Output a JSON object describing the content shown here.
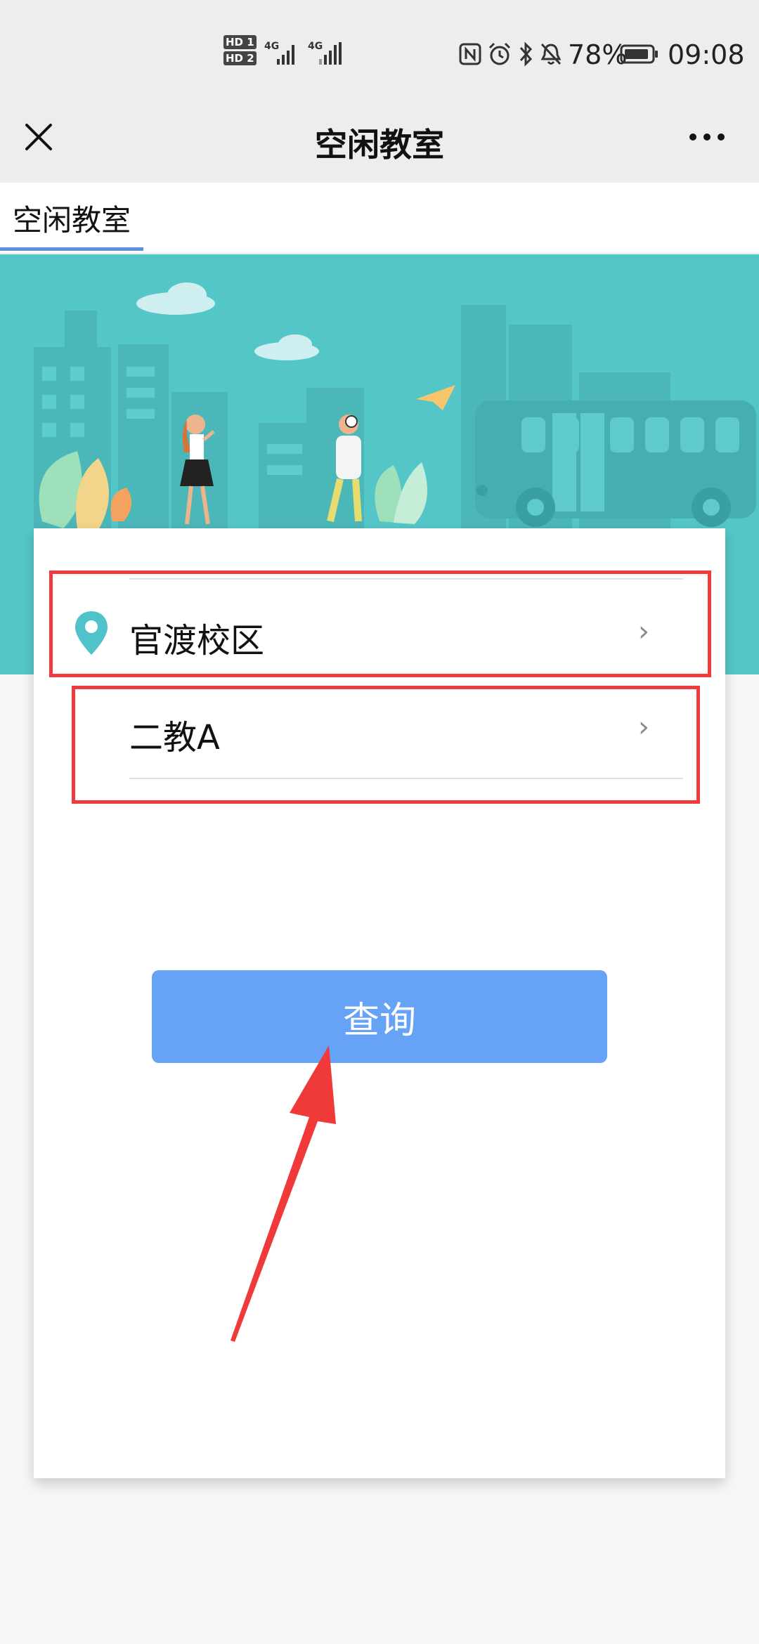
{
  "status_bar": {
    "hd1": "HD 1",
    "hd2": "HD 2",
    "net1": "4G",
    "net2": "4G",
    "battery": "78%",
    "time": "09:08"
  },
  "nav": {
    "title": "空闲教室",
    "close_icon": "close-icon",
    "more_icon": "more-icon"
  },
  "tab": {
    "label": "空闲教室"
  },
  "form": {
    "campus": "官渡校区",
    "building": "二教A"
  },
  "actions": {
    "query_label": "查询"
  },
  "colors": {
    "accent": "#66a2f6",
    "banner": "#55c6c8",
    "highlight": "#ef3b3b",
    "pin": "#4fc3c9"
  }
}
